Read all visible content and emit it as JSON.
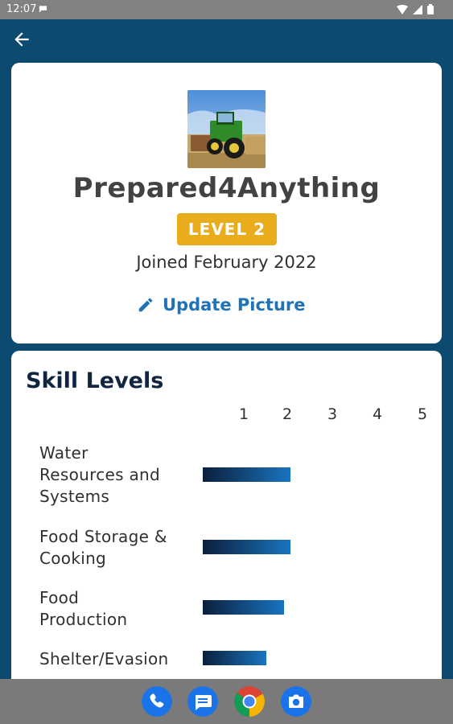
{
  "status_bar": {
    "time": "12:07"
  },
  "profile": {
    "username": "Prepared4Anything",
    "level": "LEVEL 2",
    "joined": "Joined February 2022",
    "update_picture": "Update Picture"
  },
  "skills": {
    "title": "Skill Levels",
    "scale": [
      "1",
      "2",
      "3",
      "4",
      "5"
    ],
    "items": [
      {
        "label_lines": [
          "Water",
          "Resources and",
          "Systems"
        ],
        "level": 2.05
      },
      {
        "label_lines": [
          "Food Storage &",
          "Cooking"
        ],
        "level": 2.05
      },
      {
        "label_lines": [
          "Food",
          "Production"
        ],
        "level": 1.9
      },
      {
        "label_lines": [
          "Shelter/Evasion"
        ],
        "level": 1.5
      }
    ]
  },
  "colors": {
    "app_background": "#0c4a70",
    "level_badge": "#e8ac1c",
    "link": "#1f72b5",
    "bar_start": "#0b1f3c",
    "bar_end": "#1974c0"
  },
  "dock": {
    "icons": [
      "phone-icon",
      "messages-icon",
      "chrome-icon",
      "camera-icon"
    ]
  }
}
